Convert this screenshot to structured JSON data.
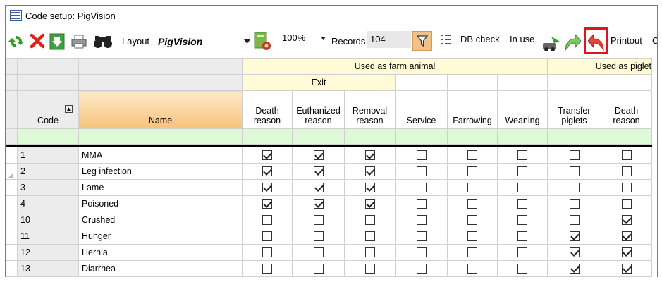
{
  "window": {
    "title": "Code setup: PigVision"
  },
  "toolbar": {
    "layout_label": "Layout",
    "layout_value": "PigVision",
    "zoom": "100%",
    "records_label": "Records",
    "records_count": "104",
    "db_check": "DB check",
    "in_use": "In use",
    "printout": "Printout",
    "trailing": "C",
    "icons": [
      "refresh-icon",
      "delete-icon",
      "export-icon",
      "print-icon",
      "binoculars-icon",
      "report-settings-icon",
      "filter-icon",
      "column-settings-icon",
      "db-check-icon",
      "in-use-icon",
      "arrow-green-icon",
      "arrow-red-icon"
    ]
  },
  "grid": {
    "groups": {
      "farm": "Used as farm animal",
      "piglet": "Used as piglet",
      "exit": "Exit"
    },
    "headers": {
      "code": "Code",
      "name": "Name",
      "death_reason": [
        "Death",
        "reason"
      ],
      "euthanized_reason": [
        "Euthanized",
        "reason"
      ],
      "removal_reason": [
        "Removal",
        "reason"
      ],
      "service": "Service",
      "farrowing": "Farrowing",
      "weaning": "Weaning",
      "transfer_piglets": [
        "Transfer",
        "piglets"
      ],
      "piglet_death_reason": [
        "Death",
        "reason"
      ]
    },
    "rows": [
      {
        "code": "1",
        "name": "MMA",
        "checks": [
          true,
          true,
          true,
          false,
          false,
          false,
          false,
          false
        ]
      },
      {
        "code": "2",
        "name": "Leg infection",
        "checks": [
          true,
          true,
          true,
          false,
          false,
          false,
          false,
          false
        ]
      },
      {
        "code": "3",
        "name": "Lame",
        "checks": [
          true,
          true,
          true,
          false,
          false,
          false,
          false,
          false
        ]
      },
      {
        "code": "4",
        "name": "Poisoned",
        "checks": [
          true,
          true,
          true,
          false,
          false,
          false,
          false,
          false
        ]
      },
      {
        "code": "10",
        "name": "Crushed",
        "checks": [
          false,
          false,
          false,
          false,
          false,
          false,
          false,
          true
        ]
      },
      {
        "code": "11",
        "name": "Hunger",
        "checks": [
          false,
          false,
          false,
          false,
          false,
          false,
          true,
          true
        ]
      },
      {
        "code": "12",
        "name": "Hernia",
        "checks": [
          false,
          false,
          false,
          false,
          false,
          false,
          true,
          true
        ]
      },
      {
        "code": "13",
        "name": "Diarrhea",
        "checks": [
          false,
          false,
          false,
          false,
          false,
          false,
          true,
          true
        ]
      }
    ]
  }
}
